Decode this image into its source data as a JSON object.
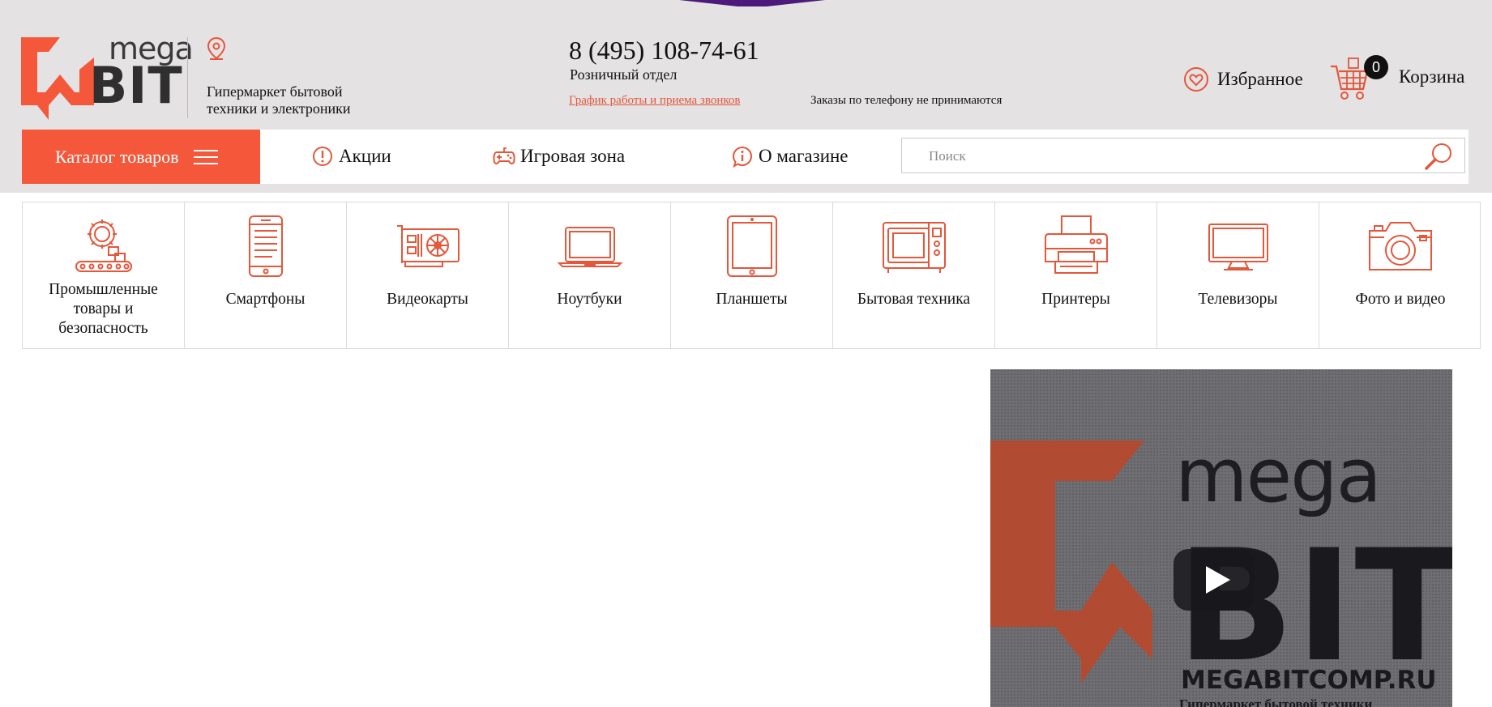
{
  "brand": {
    "logo_top": "mega",
    "logo_bottom": "BIT",
    "tagline": "Гипермаркет бытовой техники и электроники",
    "accent_color": "#f4573a"
  },
  "contact": {
    "phone": "8 (495) 108-74-61",
    "department": "Розничный отдел",
    "schedule_link": "График работы и приема звонков",
    "notice": "Заказы по телефону не принимаются"
  },
  "header_actions": {
    "favorites_label": "Избранное",
    "cart_label": "Корзина",
    "cart_count": "0"
  },
  "nav": {
    "catalog_label": "Каталог товаров",
    "items": [
      {
        "label": "Акции",
        "icon": "exclamation-circle-icon"
      },
      {
        "label": "Игровая зона",
        "icon": "gamepad-icon"
      },
      {
        "label": "О магазине",
        "icon": "info-circle-icon"
      }
    ],
    "search_placeholder": "Поиск"
  },
  "categories": [
    {
      "label": "Промышленные товары и безопасность",
      "icon": "industrial-gear-icon"
    },
    {
      "label": "Смартфоны",
      "icon": "smartphone-icon"
    },
    {
      "label": "Видеокарты",
      "icon": "graphics-card-icon"
    },
    {
      "label": "Ноутбуки",
      "icon": "laptop-icon"
    },
    {
      "label": "Планшеты",
      "icon": "tablet-icon"
    },
    {
      "label": "Бытовая техника",
      "icon": "microwave-icon"
    },
    {
      "label": "Принтеры",
      "icon": "printer-icon"
    },
    {
      "label": "Телевизоры",
      "icon": "tv-icon"
    },
    {
      "label": "Фото и видео",
      "icon": "camera-icon"
    }
  ],
  "video": {
    "mega": "mega",
    "bit": "BIT",
    "url": "MEGABITCOMP.RU",
    "subtitle": "Гипермаркет бытовой техники"
  }
}
